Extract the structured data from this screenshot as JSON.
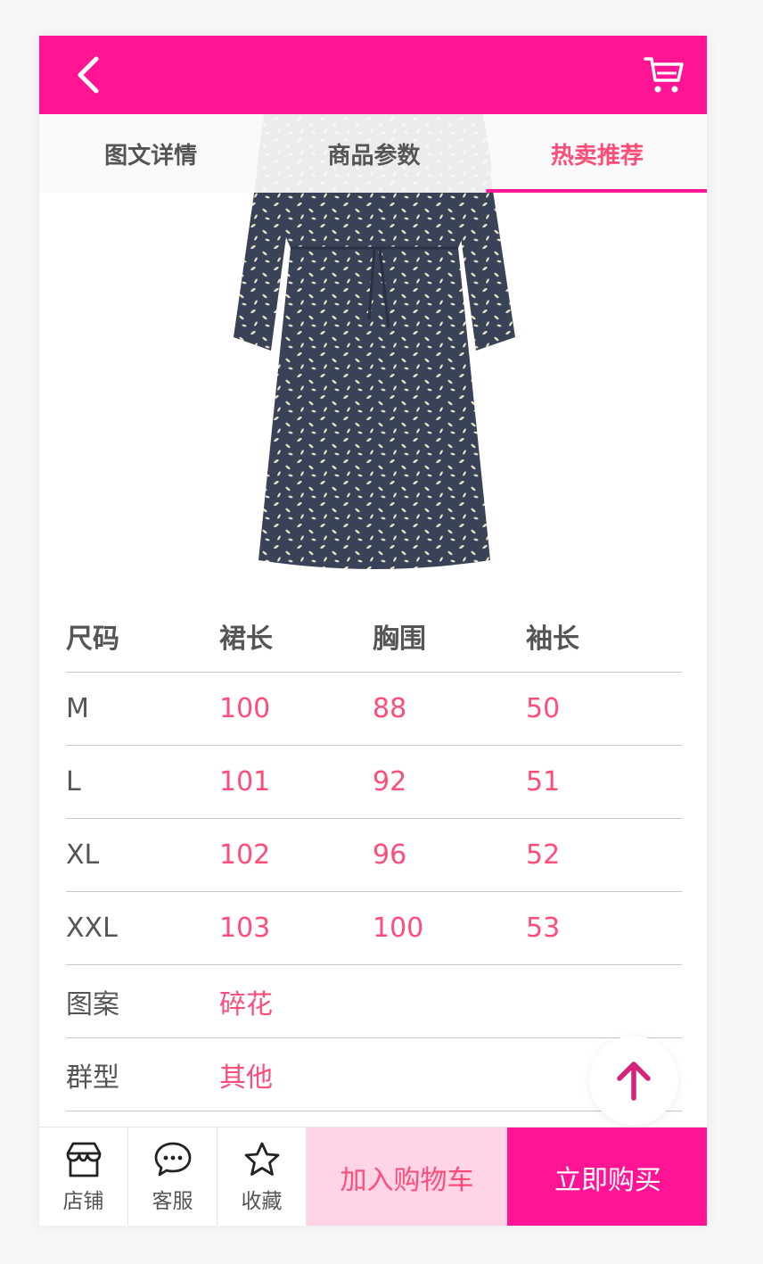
{
  "colors": {
    "brand": "#ff1493",
    "accent_text": "#ff4d79",
    "cart_button_bg": "#ffd4e6"
  },
  "header": {
    "back_icon": "chevron-left-icon",
    "cart_icon": "shopping-cart-icon"
  },
  "tabs": [
    {
      "label": "图文详情",
      "active": false
    },
    {
      "label": "商品参数",
      "active": false
    },
    {
      "label": "热卖推荐",
      "active": true
    }
  ],
  "product": {
    "image_icon": "dress-product-image"
  },
  "size_table": {
    "headers": [
      "尺码",
      "裙长",
      "胸围",
      "袖长"
    ],
    "rows": [
      [
        "M",
        "100",
        "88",
        "50"
      ],
      [
        "L",
        "101",
        "92",
        "51"
      ],
      [
        "XL",
        "102",
        "96",
        "52"
      ],
      [
        "XXL",
        "103",
        "100",
        "53"
      ]
    ]
  },
  "attributes": [
    {
      "label": "图案",
      "value": "碎花"
    },
    {
      "label": "群型",
      "value": "其他"
    }
  ],
  "back_to_top_icon": "arrow-up-icon",
  "bottom_bar": {
    "shop": {
      "label": "店铺",
      "icon": "shop-icon"
    },
    "service": {
      "label": "客服",
      "icon": "chat-bubble-icon"
    },
    "favorite": {
      "label": "收藏",
      "icon": "star-icon"
    },
    "add_to_cart": "加入购物车",
    "buy_now": "立即购买"
  }
}
